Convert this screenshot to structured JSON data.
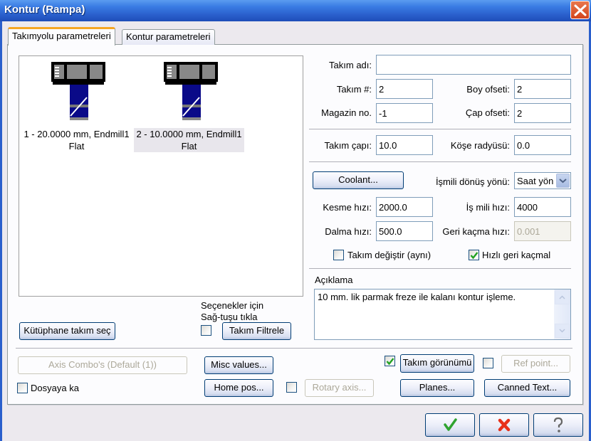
{
  "window": {
    "title": "Kontur (Rampa)",
    "close_icon": "close-x-icon"
  },
  "tabs": [
    {
      "label": "Takımyolu parametreleri",
      "active": true
    },
    {
      "label": "Kontur parametreleri",
      "active": false
    }
  ],
  "tool_list": {
    "items": [
      {
        "label_line1": "1 - 20.0000 mm, Endmill1",
        "label_line2": "Flat",
        "icon": "endmill-tool-icon",
        "selected": false
      },
      {
        "label_line1": "2 - 10.0000 mm, Endmill1",
        "label_line2": "Flat",
        "icon": "endmill-tool-icon",
        "selected": true
      }
    ]
  },
  "left_controls": {
    "library_button": "Kütüphane takım seç",
    "hint_line1": "Seçenekler için",
    "hint_line2": "Sağ-tuşu tıkla",
    "filter_checkbox_checked": false,
    "filter_button": "Takım Filtrele"
  },
  "fields": {
    "tool_name": {
      "label": "Takım adı:",
      "value": ""
    },
    "tool_number": {
      "label": "Takım #:",
      "value": "2"
    },
    "length_offset": {
      "label": "Boy ofseti:",
      "value": "2"
    },
    "magazine_no": {
      "label": "Magazin no.",
      "value": "-1"
    },
    "dia_offset": {
      "label": "Çap ofseti:",
      "value": "2"
    },
    "tool_diameter": {
      "label": "Takım çapı:",
      "value": "10.0"
    },
    "corner_radius": {
      "label": "Köşe radyüsü:",
      "value": "0.0"
    },
    "coolant_button": "Coolant...",
    "spindle_direction": {
      "label": "İşmili dönüş yönü:",
      "value": "Saat yön"
    },
    "feed_rate": {
      "label": "Kesme hızı:",
      "value": "2000.0"
    },
    "spindle_speed": {
      "label": "İş mili hızı:",
      "value": "4000"
    },
    "plunge_rate": {
      "label": "Dalma hızı:",
      "value": "500.0"
    },
    "retract_rate": {
      "label": "Geri kaçma hızı:",
      "value": "0.001",
      "disabled": true
    },
    "change_tool": {
      "label": "Takım değiştir (aynı)",
      "checked": false
    },
    "rapid_retract": {
      "label": "Hızlı geri kaçmal",
      "checked": true
    }
  },
  "comment": {
    "label": "Açıklama",
    "value": "10 mm. lik parmak freze ile kalanı kontur işleme."
  },
  "bottom": {
    "axis_combo": "Axis Combo's (Default (1))",
    "misc_values": "Misc values...",
    "tool_display_checked": true,
    "tool_display": "Takım görünümü",
    "ref_point_checked": false,
    "ref_point": "Ref point...",
    "to_file_checked": false,
    "to_file": "Dosyaya ka",
    "home_pos": "Home pos...",
    "rotary_checked": false,
    "rotary_axis": "Rotary axis...",
    "planes": "Planes...",
    "canned_text": "Canned Text..."
  },
  "dialog_buttons": {
    "ok_icon": "green-check-icon",
    "cancel_icon": "red-x-icon",
    "help_icon": "question-mark-icon"
  }
}
